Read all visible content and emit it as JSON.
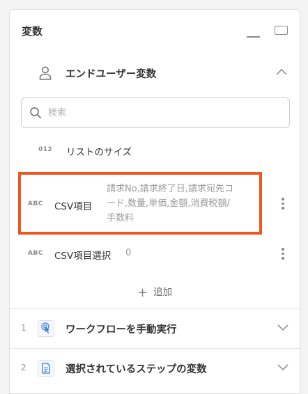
{
  "panel": {
    "title": "変数"
  },
  "section": {
    "title": "エンドユーザー変数"
  },
  "search": {
    "placeholder": "検索"
  },
  "variables": [
    {
      "type": "012",
      "name": "リストのサイズ",
      "value": ""
    },
    {
      "type": "ABC",
      "name": "CSV項目",
      "value_lines": [
        "請求No,請求終了日,請求宛先コ",
        "ード,数量,単価,金額,消費税額/",
        "手数料"
      ]
    },
    {
      "type": "ABC",
      "name": "CSV項目選択",
      "value": "0"
    }
  ],
  "add_label": "追加",
  "steps": [
    {
      "num": "1",
      "title": "ワークフローを手動実行",
      "icon": "touch-icon"
    },
    {
      "num": "2",
      "title": "選択されているステップの変数",
      "icon": "document-icon"
    }
  ],
  "colors": {
    "highlight": "#f0561e",
    "step_icon_blue": "#3b7be0"
  }
}
